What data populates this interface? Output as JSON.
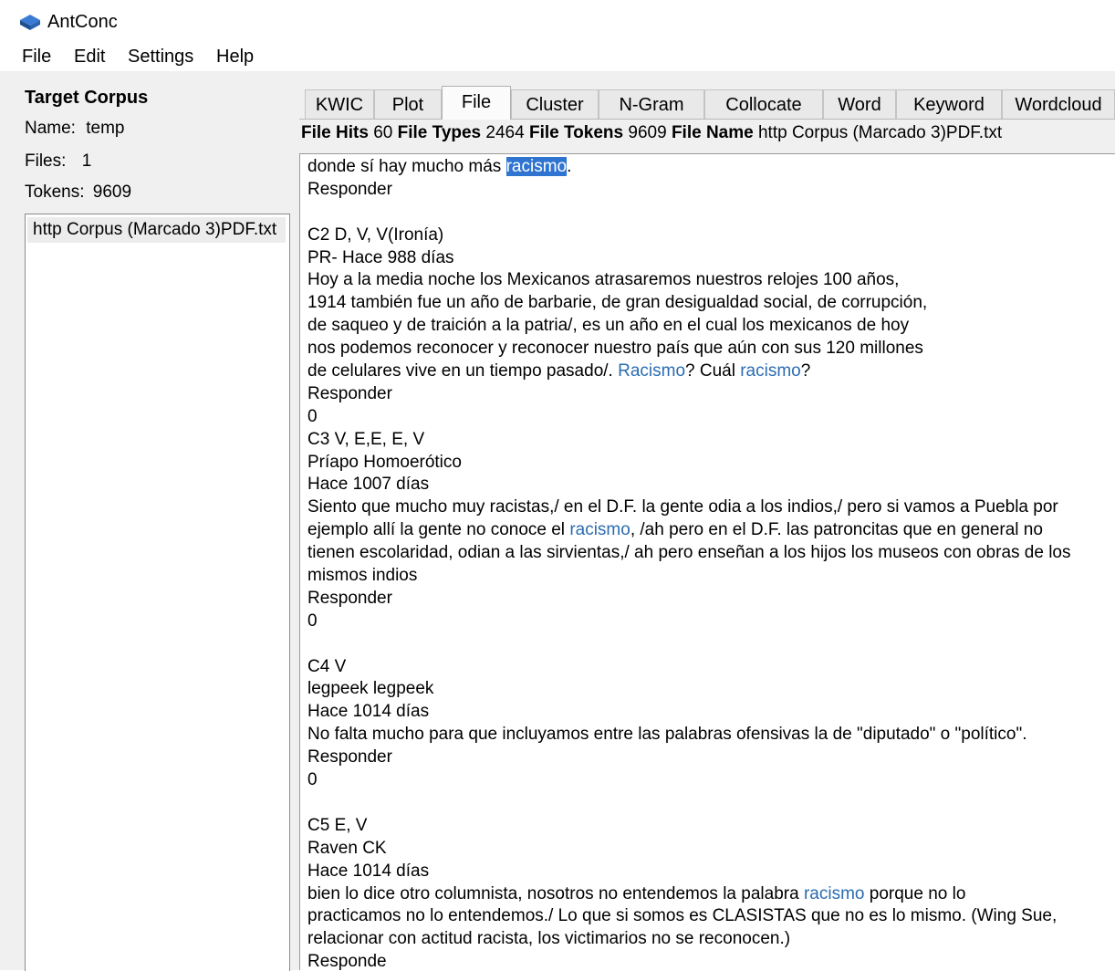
{
  "app": {
    "title": "AntConc",
    "icon": "antconc-app-icon"
  },
  "menu": {
    "items": [
      "File",
      "Edit",
      "Settings",
      "Help"
    ]
  },
  "sidebar": {
    "heading": "Target Corpus",
    "name_label": "Name:",
    "name_value": "temp",
    "files_label": "Files:",
    "files_value": "1",
    "tokens_label": "Tokens:",
    "tokens_value": "9609",
    "file_list": [
      "http Corpus (Marcado 3)PDF.txt"
    ]
  },
  "tabs": {
    "items": [
      "KWIC",
      "Plot",
      "File",
      "Cluster",
      "N-Gram",
      "Collocate",
      "Word",
      "Keyword",
      "Wordcloud"
    ],
    "active": "File"
  },
  "stats": {
    "hits_label": "File Hits",
    "hits_value": "60",
    "types_label": "File Types",
    "types_value": "2464",
    "tokens_label": "File Tokens",
    "tokens_value": "9609",
    "filename_label": "File Name",
    "filename_value": "http Corpus (Marcado 3)PDF.txt"
  },
  "colors": {
    "hit": "#2b6cb0",
    "selected_hit_bg": "#2f74d0",
    "panel_bg": "#f0f0f0"
  },
  "file_view": {
    "lines": [
      [
        "donde sí hay mucho más ",
        {
          "hit": "racismo",
          "selected": true
        },
        "."
      ],
      [
        "Responder"
      ],
      [
        ""
      ],
      [
        "C2 D, V, V(Ironía)"
      ],
      [
        "PR- Hace 988 días"
      ],
      [
        "Hoy a la media noche los Mexicanos atrasaremos nuestros relojes 100 años,"
      ],
      [
        "1914 también fue un año de barbarie, de gran desigualdad social, de corrupción,"
      ],
      [
        "de saqueo y de traición a la patria/, es un año en el cual los mexicanos de hoy"
      ],
      [
        "nos podemos reconocer y reconocer nuestro país que aún con sus 120 millones"
      ],
      [
        "de celulares vive en un tiempo pasado/. ",
        {
          "hit": "Racismo"
        },
        "? Cuál ",
        {
          "hit": "racismo"
        },
        "?"
      ],
      [
        "Responder"
      ],
      [
        "0"
      ],
      [
        "C3 V, E,E, E, V"
      ],
      [
        "Príapo Homoerótico"
      ],
      [
        "Hace 1007 días"
      ],
      [
        "Siento que mucho muy racistas,/ en el D.F. la gente odia a los indios,/ pero si vamos a Puebla por"
      ],
      [
        "ejemplo allí la gente no conoce el ",
        {
          "hit": "racismo"
        },
        ", /ah pero en el D.F. las patroncitas que en general no"
      ],
      [
        "tienen escolaridad, odian a las sirvientas,/ ah pero enseñan a los hijos los museos con obras de los"
      ],
      [
        "mismos indios"
      ],
      [
        "Responder"
      ],
      [
        "0"
      ],
      [
        ""
      ],
      [
        "C4 V"
      ],
      [
        "legpeek legpeek"
      ],
      [
        "Hace 1014 días"
      ],
      [
        "No falta mucho para que incluyamos entre las palabras ofensivas la de \"diputado\" o \"político\"."
      ],
      [
        "Responder"
      ],
      [
        "0"
      ],
      [
        ""
      ],
      [
        "C5 E, V"
      ],
      [
        "Raven CK"
      ],
      [
        "Hace 1014 días"
      ],
      [
        "bien lo dice otro columnista, nosotros no entendemos la palabra ",
        {
          "hit": "racismo"
        },
        " porque no lo"
      ],
      [
        "practicamos no lo entendemos./ Lo que si somos es CLASISTAS que no es lo mismo. (Wing Sue,"
      ],
      [
        "relacionar con actitud racista, los victimarios no se reconocen.)"
      ],
      [
        "Responde"
      ]
    ]
  }
}
